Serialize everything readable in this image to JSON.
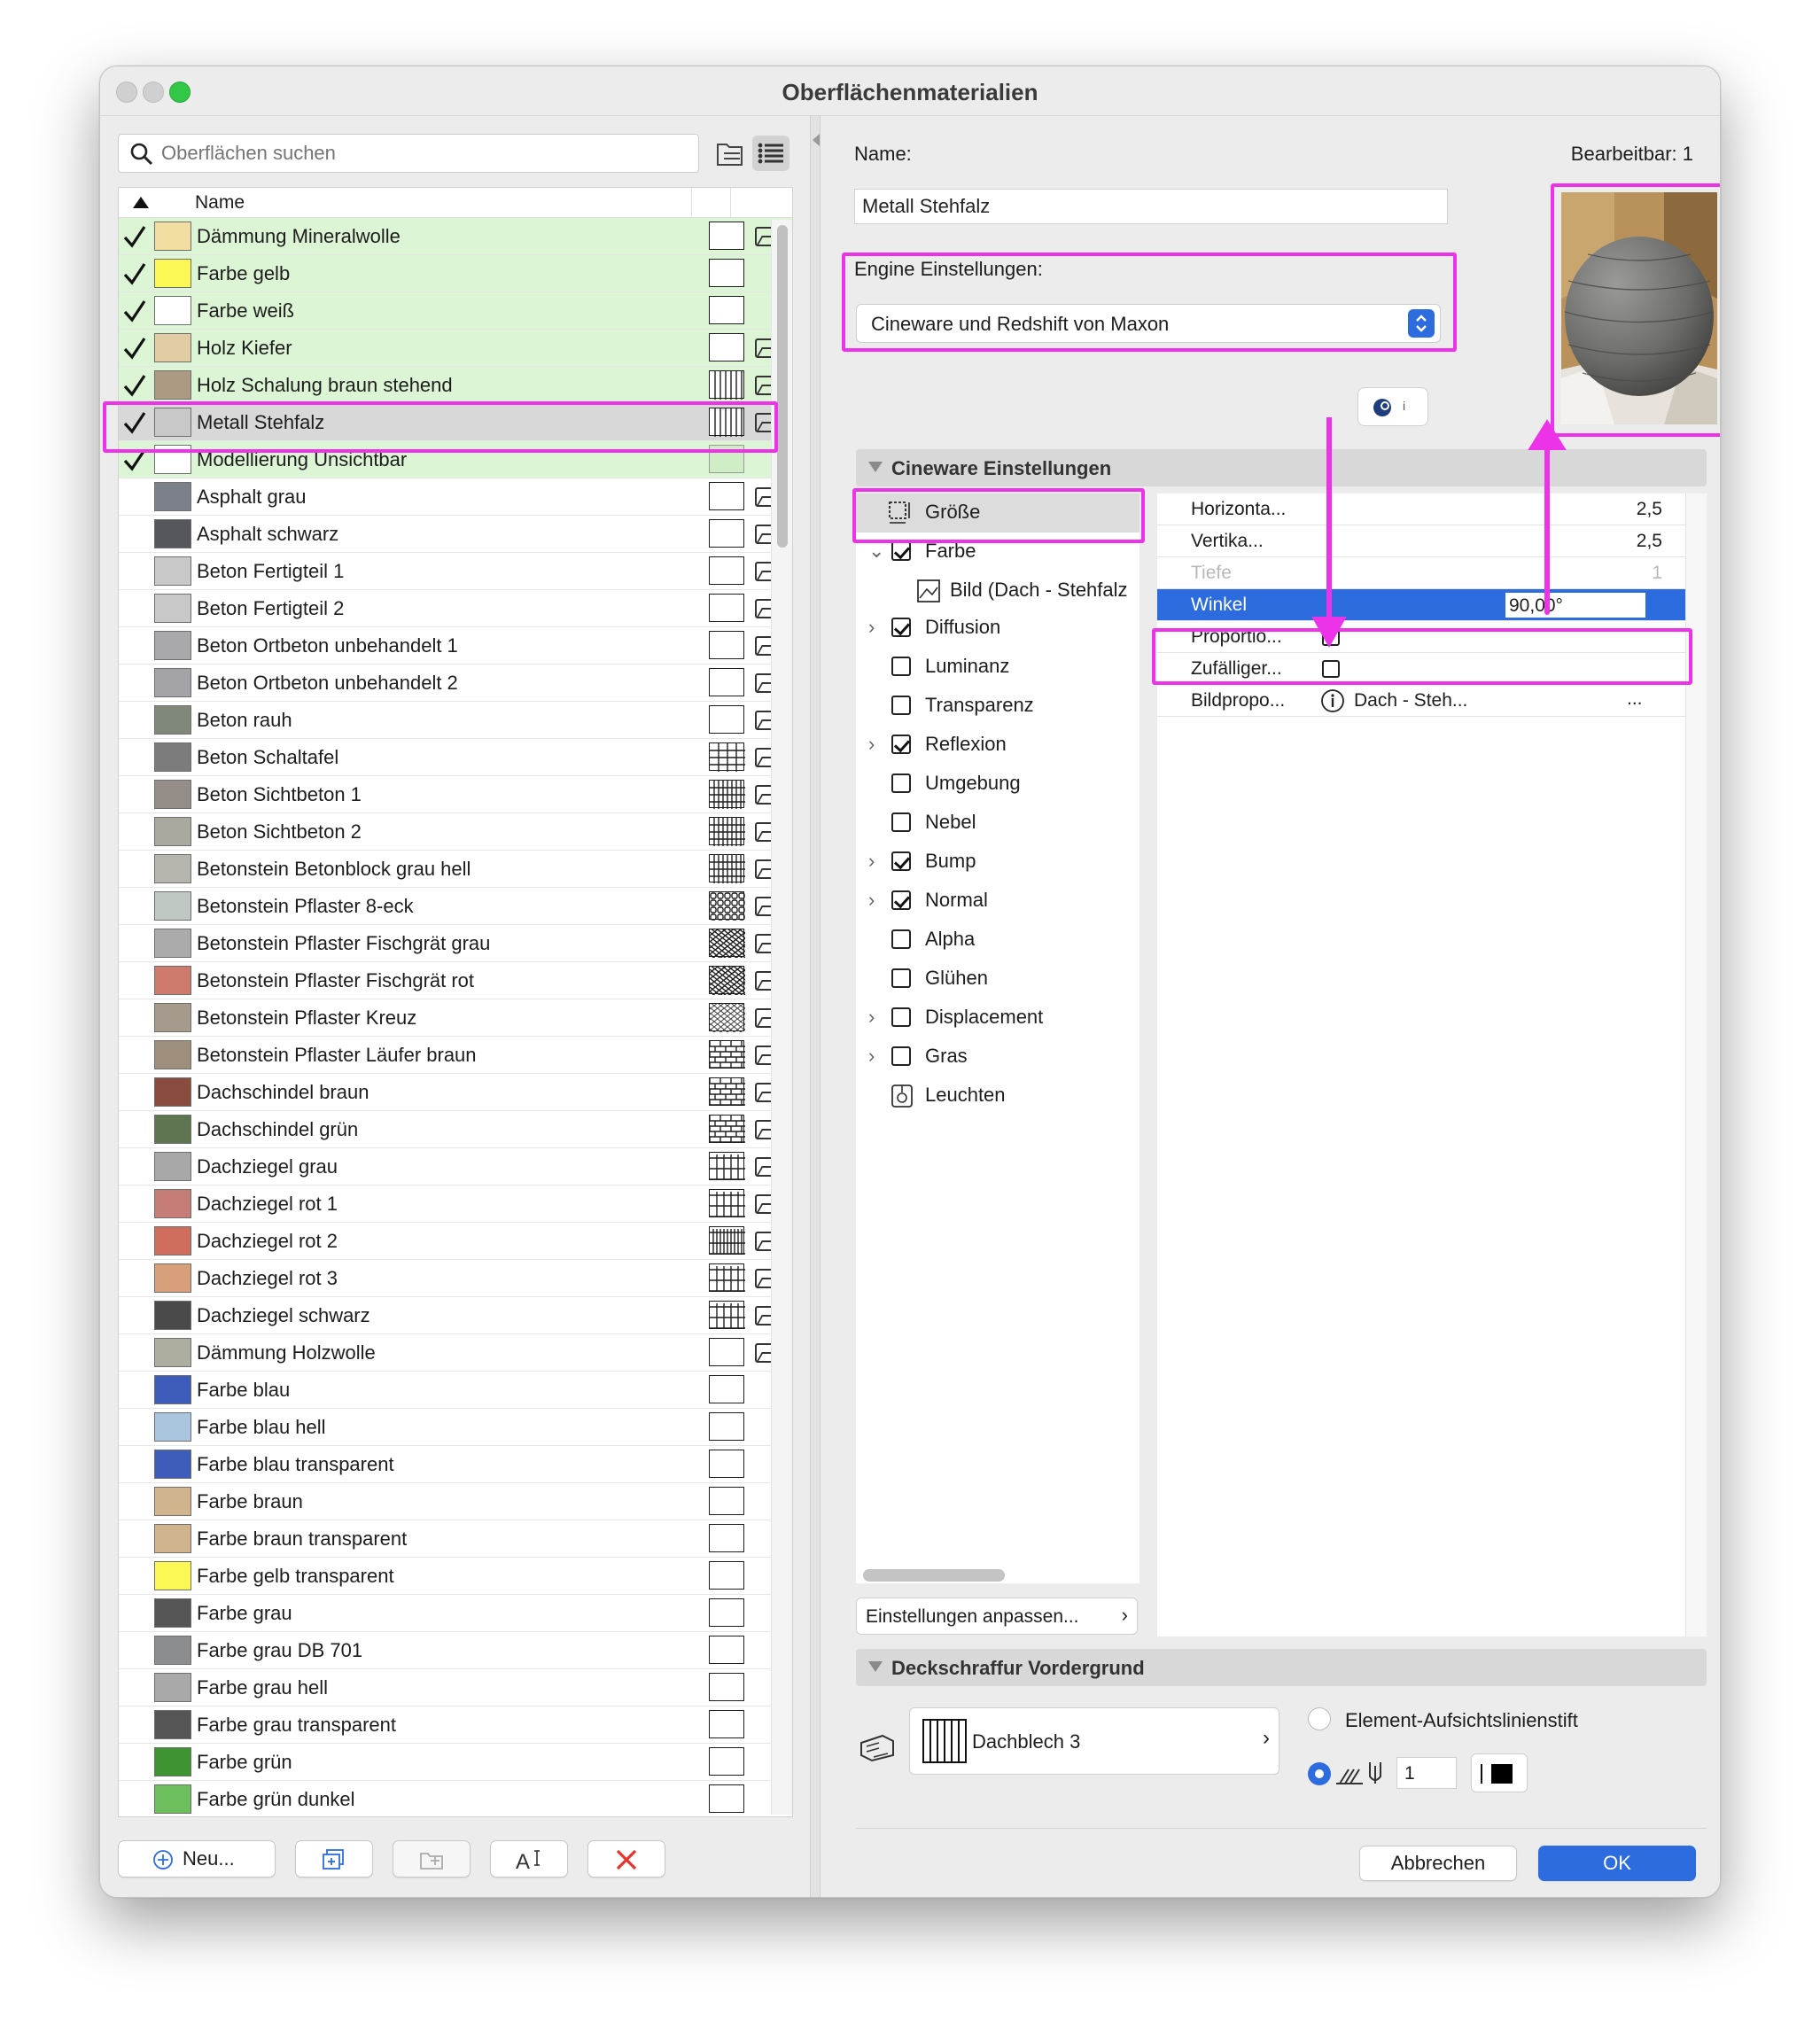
{
  "window": {
    "title": "Oberflächenmaterialien"
  },
  "search": {
    "placeholder": "Oberflächen suchen"
  },
  "list": {
    "header": "Name",
    "items": [
      {
        "name": "Dämmung Mineralwolle",
        "color": "#f2dea0",
        "checked": true,
        "pattern": "empty",
        "texture": true
      },
      {
        "name": "Farbe gelb",
        "color": "#fbf855",
        "checked": true,
        "pattern": "empty",
        "texture": false
      },
      {
        "name": "Farbe weiß",
        "color": "#ffffff",
        "checked": true,
        "pattern": "empty",
        "texture": false
      },
      {
        "name": "Holz Kiefer",
        "color": "#e1cca4",
        "checked": true,
        "pattern": "empty",
        "texture": true
      },
      {
        "name": "Holz Schalung braun stehend",
        "color": "#ad9a82",
        "checked": true,
        "pattern": "vlines",
        "texture": true
      },
      {
        "name": "Metall Stehfalz",
        "color": "#c8c8c8",
        "checked": true,
        "pattern": "vlines",
        "texture": true
      },
      {
        "name": "Modellierung Unsichtbar",
        "color": "#ffffff",
        "checked": true,
        "pattern": "green",
        "texture": false
      },
      {
        "name": "Asphalt grau",
        "color": "#7c8088",
        "checked": false,
        "pattern": "empty",
        "texture": true
      },
      {
        "name": "Asphalt schwarz",
        "color": "#55575d",
        "checked": false,
        "pattern": "empty",
        "texture": true
      },
      {
        "name": "Beton Fertigteil 1",
        "color": "#c8c8c8",
        "checked": false,
        "pattern": "empty",
        "texture": true
      },
      {
        "name": "Beton Fertigteil 2",
        "color": "#c8c8c8",
        "checked": false,
        "pattern": "empty",
        "texture": true
      },
      {
        "name": "Beton Ortbeton unbehandelt 1",
        "color": "#a9a9ac",
        "checked": false,
        "pattern": "empty",
        "texture": true
      },
      {
        "name": "Beton Ortbeton unbehandelt 2",
        "color": "#a4a4a8",
        "checked": false,
        "pattern": "empty",
        "texture": true
      },
      {
        "name": "Beton rauh",
        "color": "#7f8879",
        "checked": false,
        "pattern": "empty",
        "texture": true
      },
      {
        "name": "Beton Schaltafel",
        "color": "#7c7c7c",
        "checked": false,
        "pattern": "grid",
        "texture": true
      },
      {
        "name": "Beton Sichtbeton 1",
        "color": "#958e88",
        "checked": false,
        "pattern": "finegrid",
        "texture": true
      },
      {
        "name": "Beton Sichtbeton 2",
        "color": "#a9a9a0",
        "checked": false,
        "pattern": "finegrid",
        "texture": true
      },
      {
        "name": "Betonstein Betonblock grau hell",
        "color": "#b5b5ad",
        "checked": false,
        "pattern": "finegrid",
        "texture": true
      },
      {
        "name": "Betonstein Pflaster 8-eck",
        "color": "#c0c8c4",
        "checked": false,
        "pattern": "octa",
        "texture": true
      },
      {
        "name": "Betonstein Pflaster Fischgrät grau",
        "color": "#ababab",
        "checked": false,
        "pattern": "herring",
        "texture": true
      },
      {
        "name": "Betonstein Pflaster Fischgrät rot",
        "color": "#ce7a6c",
        "checked": false,
        "pattern": "herring",
        "texture": true
      },
      {
        "name": "Betonstein Pflaster Kreuz",
        "color": "#a59a8c",
        "checked": false,
        "pattern": "cross",
        "texture": true
      },
      {
        "name": "Betonstein Pflaster Läufer braun",
        "color": "#9e8e7c",
        "checked": false,
        "pattern": "brick",
        "texture": true
      },
      {
        "name": "Dachschindel braun",
        "color": "#8a4c3e",
        "checked": false,
        "pattern": "brick",
        "texture": true
      },
      {
        "name": "Dachschindel grün",
        "color": "#5f7450",
        "checked": false,
        "pattern": "brick",
        "texture": true
      },
      {
        "name": "Dachziegel grau",
        "color": "#a8a8a8",
        "checked": false,
        "pattern": "tile",
        "texture": true
      },
      {
        "name": "Dachziegel rot 1",
        "color": "#c67c77",
        "checked": false,
        "pattern": "tile",
        "texture": true
      },
      {
        "name": "Dachziegel rot 2",
        "color": "#d06e5e",
        "checked": false,
        "pattern": "tile2",
        "texture": true
      },
      {
        "name": "Dachziegel rot 3",
        "color": "#d7a07a",
        "checked": false,
        "pattern": "tile",
        "texture": true
      },
      {
        "name": "Dachziegel schwarz",
        "color": "#4a4a4a",
        "checked": false,
        "pattern": "tile",
        "texture": true
      },
      {
        "name": "Dämmung Holzwolle",
        "color": "#adada0",
        "checked": false,
        "pattern": "empty",
        "texture": true
      },
      {
        "name": "Farbe blau",
        "color": "#3e5dba",
        "checked": false,
        "pattern": "empty",
        "texture": false
      },
      {
        "name": "Farbe blau hell",
        "color": "#a9c6de",
        "checked": false,
        "pattern": "empty",
        "texture": false
      },
      {
        "name": "Farbe blau transparent",
        "color": "#3e5dba",
        "checked": false,
        "pattern": "empty",
        "texture": false
      },
      {
        "name": "Farbe braun",
        "color": "#d0b48e",
        "checked": false,
        "pattern": "empty",
        "texture": false
      },
      {
        "name": "Farbe braun transparent",
        "color": "#d0b48e",
        "checked": false,
        "pattern": "empty",
        "texture": false
      },
      {
        "name": "Farbe gelb transparent",
        "color": "#fbf855",
        "checked": false,
        "pattern": "empty",
        "texture": false
      },
      {
        "name": "Farbe grau",
        "color": "#555555",
        "checked": false,
        "pattern": "empty",
        "texture": false
      },
      {
        "name": "Farbe grau DB 701",
        "color": "#8b8d8e",
        "checked": false,
        "pattern": "empty",
        "texture": false
      },
      {
        "name": "Farbe grau hell",
        "color": "#a9a9a9",
        "checked": false,
        "pattern": "empty",
        "texture": false
      },
      {
        "name": "Farbe grau transparent",
        "color": "#555555",
        "checked": false,
        "pattern": "empty",
        "texture": false
      },
      {
        "name": "Farbe grün",
        "color": "#3e9430",
        "checked": false,
        "pattern": "empty",
        "texture": false
      },
      {
        "name": "Farbe grün dunkel",
        "color": "#6dbf5e",
        "checked": false,
        "pattern": "empty",
        "texture": false
      }
    ]
  },
  "left_buttons": {
    "new": "Neu..."
  },
  "right": {
    "name_label": "Name:",
    "editable": "Bearbeitbar: 1",
    "name_value": "Metall Stehfalz",
    "engine_label": "Engine Einstellungen:",
    "engine_value": "Cineware und Redshift von Maxon",
    "cineware_section": "Cineware Einstellungen",
    "tree": [
      {
        "label": "Größe",
        "kind": "size",
        "chevron": "",
        "checked": null
      },
      {
        "label": "Farbe",
        "kind": "check",
        "chevron": "⌄",
        "checked": true
      },
      {
        "label": "Bild (Dach - Stehfalz",
        "kind": "image",
        "chevron": "",
        "checked": null
      },
      {
        "label": "Diffusion",
        "kind": "check",
        "chevron": "›",
        "checked": true
      },
      {
        "label": "Luminanz",
        "kind": "check",
        "chevron": "",
        "checked": false
      },
      {
        "label": "Transparenz",
        "kind": "check",
        "chevron": "",
        "checked": false
      },
      {
        "label": "Reflexion",
        "kind": "check",
        "chevron": "›",
        "checked": true
      },
      {
        "label": "Umgebung",
        "kind": "check",
        "chevron": "",
        "checked": false
      },
      {
        "label": "Nebel",
        "kind": "check",
        "chevron": "",
        "checked": false
      },
      {
        "label": "Bump",
        "kind": "check",
        "chevron": "›",
        "checked": true
      },
      {
        "label": "Normal",
        "kind": "check",
        "chevron": "›",
        "checked": true
      },
      {
        "label": "Alpha",
        "kind": "check",
        "chevron": "",
        "checked": false
      },
      {
        "label": "Glühen",
        "kind": "check",
        "chevron": "",
        "checked": false
      },
      {
        "label": "Displacement",
        "kind": "check",
        "chevron": "›",
        "checked": false
      },
      {
        "label": "Gras",
        "kind": "check",
        "chevron": "›",
        "checked": false
      },
      {
        "label": "Leuchten",
        "kind": "light",
        "chevron": "",
        "checked": null
      }
    ],
    "props": {
      "horizontal": {
        "label": "Horizon⁠ta...",
        "value": "2,5"
      },
      "vertikal": {
        "label": "Vertika...",
        "value": "2,5"
      },
      "tiefe": {
        "label": "Tiefe",
        "value": "1"
      },
      "winkel": {
        "label": "Winkel",
        "value": "90,00°"
      },
      "proportion": {
        "label": "Proportio..."
      },
      "zufaellig": {
        "label": "Zufälliger..."
      },
      "bildprop": {
        "label": "Bildpropo...",
        "value": "Dach - Steh...",
        "more": "..."
      }
    },
    "adjust_button": "Einstellungen anpassen...",
    "foreground_section": "Deckschraffur Vordergrund",
    "fill_name": "Dachblech 3",
    "pen_option": "Element-Aufsichtslinienstift",
    "pen_number": "1",
    "cancel": "Abbrechen",
    "ok": "OK"
  },
  "colors": {
    "accent": "#2d6cdf",
    "highlight": "#ec33e8",
    "green_row": "#dcf5d5",
    "cancel_x": "#e8322c"
  }
}
